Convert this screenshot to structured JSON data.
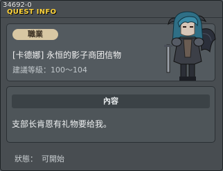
{
  "window": {
    "quest_id": "34692-0",
    "title": "QUEST INFO"
  },
  "info": {
    "job_tag": "職業",
    "npc_name": "[卡德娜] 永恒的影子商团信物",
    "level_label": "建議等級：",
    "level_range": "100～104",
    "npc_icon": "demon-npc-portrait"
  },
  "content": {
    "header": "內容",
    "text": "支部长肯恩有礼物要给我。"
  },
  "status": {
    "label": "狀態：",
    "value": "可開始"
  },
  "colors": {
    "title": "#ffd43a",
    "tag_bg": "#d8c7a3",
    "panel_bg": "#535a5f",
    "window_bg": "#484d51"
  }
}
